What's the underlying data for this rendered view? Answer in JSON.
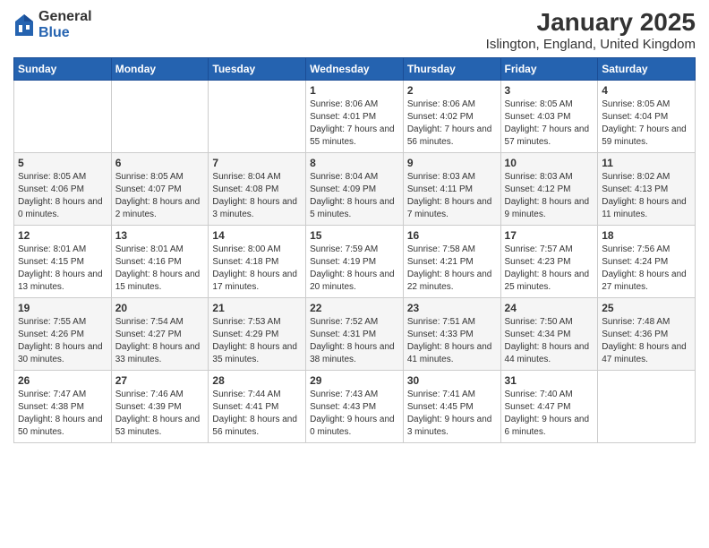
{
  "title": "January 2025",
  "subtitle": "Islington, England, United Kingdom",
  "logo": {
    "general": "General",
    "blue": "Blue"
  },
  "headers": [
    "Sunday",
    "Monday",
    "Tuesday",
    "Wednesday",
    "Thursday",
    "Friday",
    "Saturday"
  ],
  "weeks": [
    {
      "days": [
        {
          "number": "",
          "sunrise": "",
          "sunset": "",
          "daylight": ""
        },
        {
          "number": "",
          "sunrise": "",
          "sunset": "",
          "daylight": ""
        },
        {
          "number": "",
          "sunrise": "",
          "sunset": "",
          "daylight": ""
        },
        {
          "number": "1",
          "sunrise": "Sunrise: 8:06 AM",
          "sunset": "Sunset: 4:01 PM",
          "daylight": "Daylight: 7 hours and 55 minutes."
        },
        {
          "number": "2",
          "sunrise": "Sunrise: 8:06 AM",
          "sunset": "Sunset: 4:02 PM",
          "daylight": "Daylight: 7 hours and 56 minutes."
        },
        {
          "number": "3",
          "sunrise": "Sunrise: 8:05 AM",
          "sunset": "Sunset: 4:03 PM",
          "daylight": "Daylight: 7 hours and 57 minutes."
        },
        {
          "number": "4",
          "sunrise": "Sunrise: 8:05 AM",
          "sunset": "Sunset: 4:04 PM",
          "daylight": "Daylight: 7 hours and 59 minutes."
        }
      ]
    },
    {
      "days": [
        {
          "number": "5",
          "sunrise": "Sunrise: 8:05 AM",
          "sunset": "Sunset: 4:06 PM",
          "daylight": "Daylight: 8 hours and 0 minutes."
        },
        {
          "number": "6",
          "sunrise": "Sunrise: 8:05 AM",
          "sunset": "Sunset: 4:07 PM",
          "daylight": "Daylight: 8 hours and 2 minutes."
        },
        {
          "number": "7",
          "sunrise": "Sunrise: 8:04 AM",
          "sunset": "Sunset: 4:08 PM",
          "daylight": "Daylight: 8 hours and 3 minutes."
        },
        {
          "number": "8",
          "sunrise": "Sunrise: 8:04 AM",
          "sunset": "Sunset: 4:09 PM",
          "daylight": "Daylight: 8 hours and 5 minutes."
        },
        {
          "number": "9",
          "sunrise": "Sunrise: 8:03 AM",
          "sunset": "Sunset: 4:11 PM",
          "daylight": "Daylight: 8 hours and 7 minutes."
        },
        {
          "number": "10",
          "sunrise": "Sunrise: 8:03 AM",
          "sunset": "Sunset: 4:12 PM",
          "daylight": "Daylight: 8 hours and 9 minutes."
        },
        {
          "number": "11",
          "sunrise": "Sunrise: 8:02 AM",
          "sunset": "Sunset: 4:13 PM",
          "daylight": "Daylight: 8 hours and 11 minutes."
        }
      ]
    },
    {
      "days": [
        {
          "number": "12",
          "sunrise": "Sunrise: 8:01 AM",
          "sunset": "Sunset: 4:15 PM",
          "daylight": "Daylight: 8 hours and 13 minutes."
        },
        {
          "number": "13",
          "sunrise": "Sunrise: 8:01 AM",
          "sunset": "Sunset: 4:16 PM",
          "daylight": "Daylight: 8 hours and 15 minutes."
        },
        {
          "number": "14",
          "sunrise": "Sunrise: 8:00 AM",
          "sunset": "Sunset: 4:18 PM",
          "daylight": "Daylight: 8 hours and 17 minutes."
        },
        {
          "number": "15",
          "sunrise": "Sunrise: 7:59 AM",
          "sunset": "Sunset: 4:19 PM",
          "daylight": "Daylight: 8 hours and 20 minutes."
        },
        {
          "number": "16",
          "sunrise": "Sunrise: 7:58 AM",
          "sunset": "Sunset: 4:21 PM",
          "daylight": "Daylight: 8 hours and 22 minutes."
        },
        {
          "number": "17",
          "sunrise": "Sunrise: 7:57 AM",
          "sunset": "Sunset: 4:23 PM",
          "daylight": "Daylight: 8 hours and 25 minutes."
        },
        {
          "number": "18",
          "sunrise": "Sunrise: 7:56 AM",
          "sunset": "Sunset: 4:24 PM",
          "daylight": "Daylight: 8 hours and 27 minutes."
        }
      ]
    },
    {
      "days": [
        {
          "number": "19",
          "sunrise": "Sunrise: 7:55 AM",
          "sunset": "Sunset: 4:26 PM",
          "daylight": "Daylight: 8 hours and 30 minutes."
        },
        {
          "number": "20",
          "sunrise": "Sunrise: 7:54 AM",
          "sunset": "Sunset: 4:27 PM",
          "daylight": "Daylight: 8 hours and 33 minutes."
        },
        {
          "number": "21",
          "sunrise": "Sunrise: 7:53 AM",
          "sunset": "Sunset: 4:29 PM",
          "daylight": "Daylight: 8 hours and 35 minutes."
        },
        {
          "number": "22",
          "sunrise": "Sunrise: 7:52 AM",
          "sunset": "Sunset: 4:31 PM",
          "daylight": "Daylight: 8 hours and 38 minutes."
        },
        {
          "number": "23",
          "sunrise": "Sunrise: 7:51 AM",
          "sunset": "Sunset: 4:33 PM",
          "daylight": "Daylight: 8 hours and 41 minutes."
        },
        {
          "number": "24",
          "sunrise": "Sunrise: 7:50 AM",
          "sunset": "Sunset: 4:34 PM",
          "daylight": "Daylight: 8 hours and 44 minutes."
        },
        {
          "number": "25",
          "sunrise": "Sunrise: 7:48 AM",
          "sunset": "Sunset: 4:36 PM",
          "daylight": "Daylight: 8 hours and 47 minutes."
        }
      ]
    },
    {
      "days": [
        {
          "number": "26",
          "sunrise": "Sunrise: 7:47 AM",
          "sunset": "Sunset: 4:38 PM",
          "daylight": "Daylight: 8 hours and 50 minutes."
        },
        {
          "number": "27",
          "sunrise": "Sunrise: 7:46 AM",
          "sunset": "Sunset: 4:39 PM",
          "daylight": "Daylight: 8 hours and 53 minutes."
        },
        {
          "number": "28",
          "sunrise": "Sunrise: 7:44 AM",
          "sunset": "Sunset: 4:41 PM",
          "daylight": "Daylight: 8 hours and 56 minutes."
        },
        {
          "number": "29",
          "sunrise": "Sunrise: 7:43 AM",
          "sunset": "Sunset: 4:43 PM",
          "daylight": "Daylight: 9 hours and 0 minutes."
        },
        {
          "number": "30",
          "sunrise": "Sunrise: 7:41 AM",
          "sunset": "Sunset: 4:45 PM",
          "daylight": "Daylight: 9 hours and 3 minutes."
        },
        {
          "number": "31",
          "sunrise": "Sunrise: 7:40 AM",
          "sunset": "Sunset: 4:47 PM",
          "daylight": "Daylight: 9 hours and 6 minutes."
        },
        {
          "number": "",
          "sunrise": "",
          "sunset": "",
          "daylight": ""
        }
      ]
    }
  ]
}
